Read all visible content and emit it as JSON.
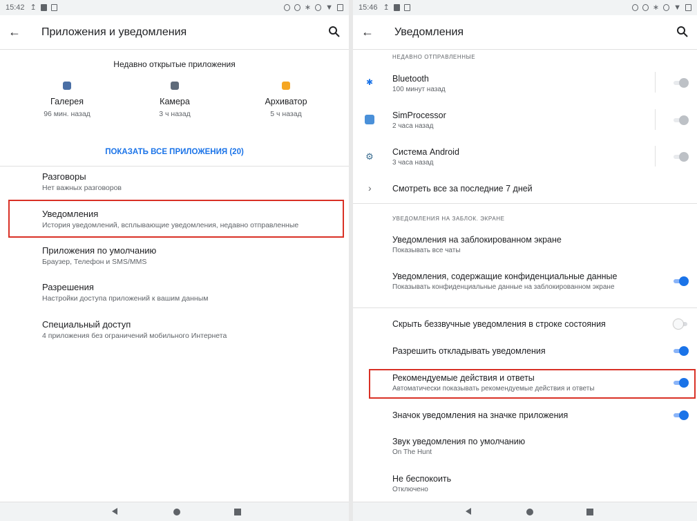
{
  "left": {
    "status_time": "15:42",
    "title": "Приложения и уведомления",
    "recent_heading": "Недавно открытые приложения",
    "recent_apps": [
      {
        "name": "Галерея",
        "time": "96 мин. назад",
        "color": "#4a6fa5"
      },
      {
        "name": "Камера",
        "time": "3 ч назад",
        "color": "#5f6b7a"
      },
      {
        "name": "Архиватор",
        "time": "5 ч назад",
        "color": "#f5a623"
      }
    ],
    "show_all": "ПОКАЗАТЬ ВСЕ ПРИЛОЖЕНИЯ (20)",
    "items": [
      {
        "title": "Разговоры",
        "subtitle": "Нет важных разговоров"
      },
      {
        "title": "Уведомления",
        "subtitle": "История уведомлений, всплывающие уведомления, недавно отправленные"
      },
      {
        "title": "Приложения по умолчанию",
        "subtitle": "Браузер, Телефон и SMS/MMS"
      },
      {
        "title": "Разрешения",
        "subtitle": "Настройки доступа приложений к вашим данным"
      },
      {
        "title": "Специальный доступ",
        "subtitle": "4 приложения без ограничений мобильного Интернета"
      }
    ]
  },
  "right": {
    "status_time": "15:46",
    "title": "Уведомления",
    "section_recent": "НЕДАВНО ОТПРАВЛЕННЫЕ",
    "recent": [
      {
        "title": "Bluetooth",
        "subtitle": "100 минут назад",
        "icon": "bluetooth-icon",
        "color": "#1a73e8"
      },
      {
        "title": "SimProcessor",
        "subtitle": "2 часа назад",
        "icon": "simprocessor-icon",
        "color": "#4a90d9"
      },
      {
        "title": "Система Android",
        "subtitle": "3 часа назад",
        "icon": "android-system-icon",
        "color": "#3c6e91"
      }
    ],
    "see_all": "Смотреть все за последние 7 дней",
    "section_lock": "УВЕДОМЛЕНИЯ НА ЗАБЛОК. ЭКРАНЕ",
    "lock_screen": {
      "title": "Уведомления на заблокированном экране",
      "subtitle": "Показывать все чаты"
    },
    "sensitive": {
      "title": "Уведомления, содержащие конфиденциальные данные",
      "subtitle": "Показывать конфиденциальные данные на заблокированном экране",
      "state": "on"
    },
    "hide_silent": {
      "title": "Скрыть беззвучные уведомления в строке состояния",
      "state": "off"
    },
    "snooze": {
      "title": "Разрешить откладывать уведомления",
      "state": "on"
    },
    "suggested": {
      "title": "Рекомендуемые действия и ответы",
      "subtitle": "Автоматически показывать рекомендуемые действия и ответы",
      "state": "on"
    },
    "badge": {
      "title": "Значок уведомления на значке приложения",
      "state": "on"
    },
    "sound": {
      "title": "Звук уведомления по умолчанию",
      "subtitle": "On The Hunt"
    },
    "dnd": {
      "title": "Не беспокоить",
      "subtitle": "Отключено"
    }
  },
  "colors": {
    "accent": "#1a73e8",
    "highlight": "#d93025"
  }
}
